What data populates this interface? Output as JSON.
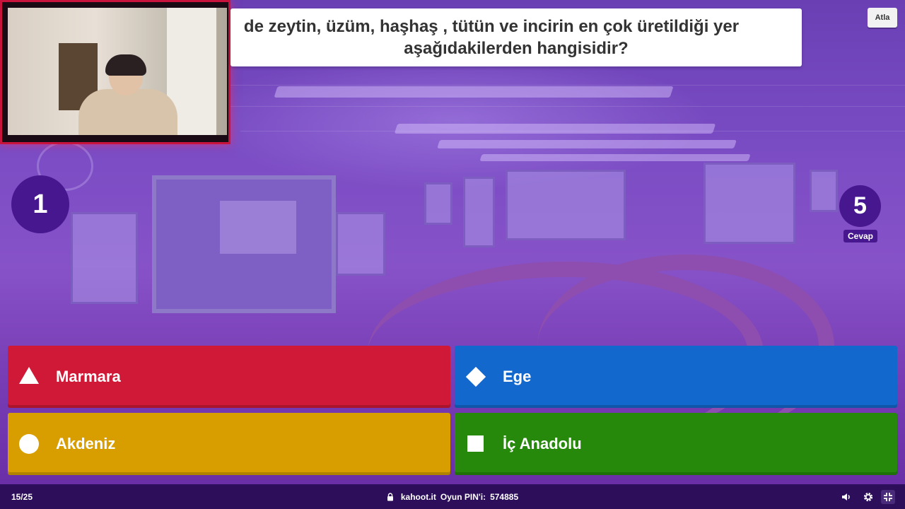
{
  "question": {
    "line1": "de zeytin, üzüm, haşhaş , tütün ve incirin en çok üretildiği yer",
    "line2": "aşağıdakilerden hangisidir?"
  },
  "skip_label": "Atla",
  "timer": "1",
  "answers_count": "5",
  "answers_label": "Cevap",
  "answers": [
    {
      "label": "Marmara",
      "shape": "triangle-icon",
      "color": "#d01937"
    },
    {
      "label": "Ege",
      "shape": "diamond-icon",
      "color": "#1368ce"
    },
    {
      "label": "Akdeniz",
      "shape": "circle-icon",
      "color": "#d89e00"
    },
    {
      "label": "İç Anadolu",
      "shape": "square-icon",
      "color": "#26890c"
    }
  ],
  "footer": {
    "progress": "15/25",
    "site": "kahoot.it",
    "pin_label": "Oyun PIN'i:",
    "pin": "574885"
  },
  "icons": {
    "lock": "lock-icon",
    "volume": "volume-icon",
    "settings": "settings-icon",
    "fullscreen": "exit-fullscreen-icon"
  }
}
